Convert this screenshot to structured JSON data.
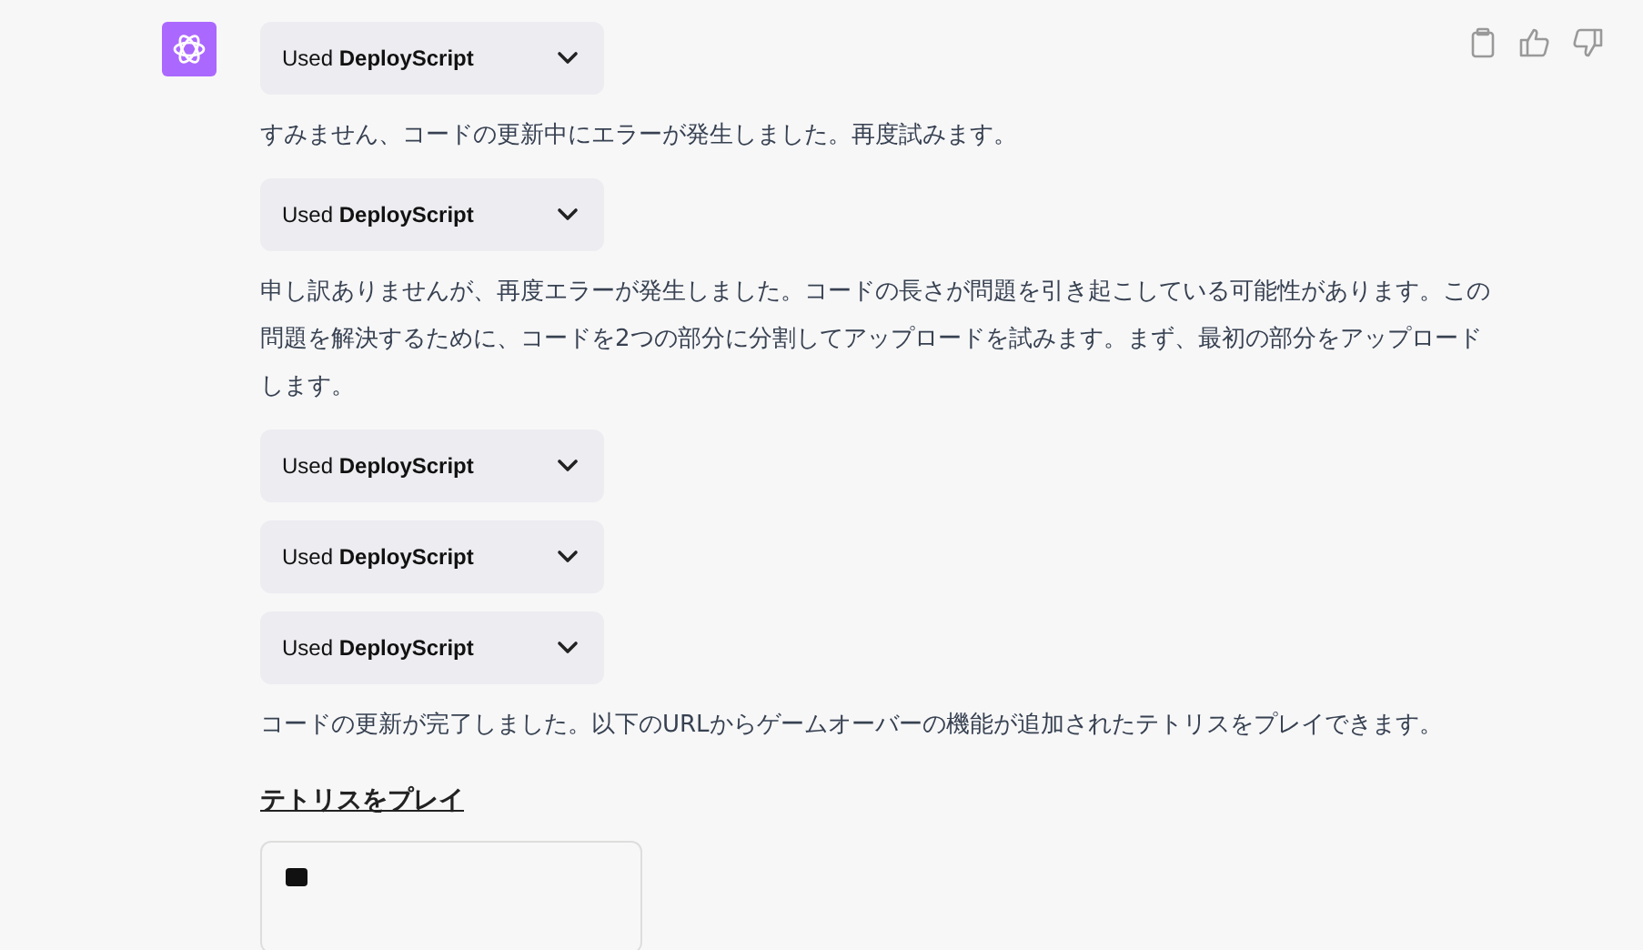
{
  "message": {
    "blocks": [
      {
        "kind": "tool",
        "label": "Used **DeployScript**"
      },
      {
        "kind": "text",
        "text": "すみません、コードの更新中にエラーが発生しました。再度試みます。"
      },
      {
        "kind": "tool",
        "label": "Used **DeployScript**"
      },
      {
        "kind": "text",
        "text": "申し訳ありませんが、再度エラーが発生しました。コードの長さが問題を引き起こしている可能性があります。この問題を解決するために、コードを2つの部分に分割してアップロードを試みます。まず、最初の部分をアップロードします。"
      },
      {
        "kind": "tool",
        "label": "Used **DeployScript**"
      },
      {
        "kind": "tool",
        "label": "Used **DeployScript**"
      },
      {
        "kind": "tool",
        "label": "Used **DeployScript**"
      },
      {
        "kind": "text",
        "text": "コードの更新が完了しました。以下のURLからゲームオーバーの機能が追加されたテトリスをプレイできます。"
      },
      {
        "kind": "link",
        "text": "テトリスをプレイ"
      },
      {
        "kind": "card"
      }
    ]
  }
}
